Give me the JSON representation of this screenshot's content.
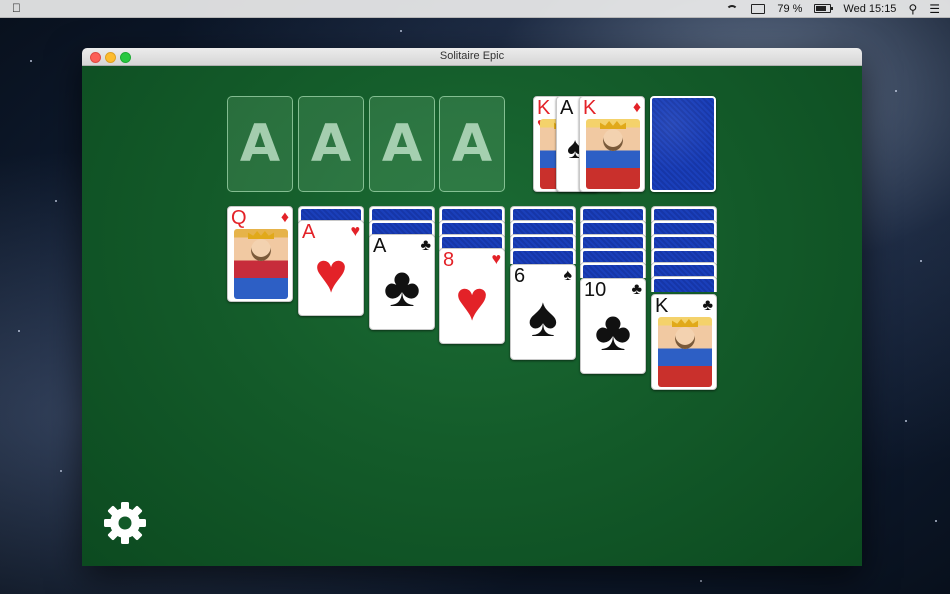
{
  "menubar": {
    "battery_percent": "79 %",
    "clock": "Wed 15:15"
  },
  "window": {
    "title": "Solitaire Epic"
  },
  "foundations": [
    {
      "label": "A"
    },
    {
      "label": "A"
    },
    {
      "label": "A"
    },
    {
      "label": "A"
    }
  ],
  "waste": [
    {
      "rank": "K",
      "suit": "♥",
      "color": "red"
    },
    {
      "rank": "A",
      "suit": "♠",
      "color": "black"
    },
    {
      "rank": "K",
      "suit": "♦",
      "color": "red"
    }
  ],
  "stock": {
    "face_down": true
  },
  "tableau": [
    {
      "hidden": 0,
      "visible": [
        {
          "rank": "Q",
          "suit": "♦",
          "color": "red",
          "face": true
        }
      ]
    },
    {
      "hidden": 1,
      "visible": [
        {
          "rank": "A",
          "suit": "♥",
          "color": "red"
        }
      ]
    },
    {
      "hidden": 2,
      "visible": [
        {
          "rank": "A",
          "suit": "♣",
          "color": "black"
        }
      ]
    },
    {
      "hidden": 3,
      "visible": [
        {
          "rank": "8",
          "suit": "♥",
          "color": "red"
        }
      ]
    },
    {
      "hidden": 4,
      "visible": [
        {
          "rank": "6",
          "suit": "♠",
          "color": "black"
        }
      ]
    },
    {
      "hidden": 5,
      "visible": [
        {
          "rank": "10",
          "suit": "♣",
          "color": "black"
        }
      ]
    },
    {
      "hidden": 6,
      "visible": [
        {
          "rank": "K",
          "suit": "♣",
          "color": "black",
          "face": true
        }
      ]
    }
  ],
  "colors": {
    "felt": "#135a29",
    "card_back": "#1a3fba",
    "red_suit": "#e32228"
  },
  "icons": {
    "settings": "gear-icon"
  }
}
